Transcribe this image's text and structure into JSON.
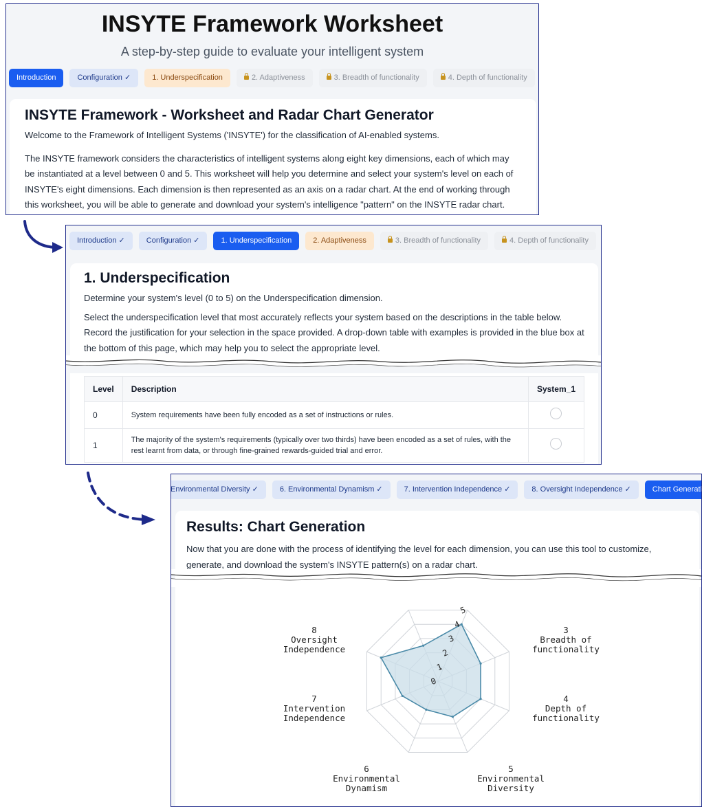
{
  "panel1": {
    "title": "INSYTE Framework Worksheet",
    "subtitle": "A step-by-step guide to evaluate your intelligent system",
    "tabs": [
      {
        "label": "Introduction"
      },
      {
        "label": "Configuration ✓"
      },
      {
        "label": "1. Underspecification"
      },
      {
        "label": "2. Adaptiveness"
      },
      {
        "label": "3. Breadth of functionality"
      },
      {
        "label": "4. Depth of functionality"
      }
    ],
    "card_title": "INSYTE Framework - Worksheet and Radar Chart Generator",
    "welcome": "Welcome to the Framework of Intelligent Systems ('INSYTE') for the classification of AI-enabled systems.",
    "body": "The INSYTE framework considers the characteristics of intelligent systems along eight key dimensions, each of which may be instantiated at a level between 0 and 5. This worksheet will help you determine and select your system's level on each of INSYTE's eight dimensions. Each dimension is then represented as an axis on a radar chart. At the end of working through this worksheet, you will be able to generate and download your system's intelligence \"pattern\" on the INSYTE radar chart."
  },
  "panel2": {
    "tabs": [
      {
        "label": "Introduction ✓"
      },
      {
        "label": "Configuration ✓"
      },
      {
        "label": "1. Underspecification"
      },
      {
        "label": "2. Adaptiveness"
      },
      {
        "label": "3. Breadth of functionality"
      },
      {
        "label": "4. Depth of functionality"
      }
    ],
    "card_title": "1. Underspecification",
    "intro": "Determine your system's level (0 to 5) on the Underspecification dimension.",
    "instructions": "Select the underspecification level that most accurately reflects your system based on the descriptions in the table below. Record the justification for your selection in the space provided. A drop-down table with examples is provided in the blue box at the bottom of this page, which may help you to select the appropriate level.",
    "table": {
      "headers": [
        "Level",
        "Description",
        "System_1"
      ],
      "rows": [
        {
          "level": "0",
          "description": "System requirements have been fully encoded as a set of instructions or rules."
        },
        {
          "level": "1",
          "description": "The majority of the system's requirements (typically over two thirds) have been encoded as a set of rules, with the rest learnt from data, or through fine-grained rewards-guided trial and error."
        }
      ]
    }
  },
  "panel3": {
    "tabs": [
      {
        "label": "Environmental Diversity ✓"
      },
      {
        "label": "6. Environmental Dynamism ✓"
      },
      {
        "label": "7. Intervention Independence ✓"
      },
      {
        "label": "8. Oversight Independence ✓"
      },
      {
        "label": "Chart Generation"
      }
    ],
    "card_title": "Results: Chart Generation",
    "body": "Now that you are done with the process of identifying the level for each dimension, you can use this tool to customize, generate, and download the system's INSYTE pattern(s) on a radar chart."
  },
  "chart_data": {
    "type": "radar",
    "axes": [
      {
        "num": "1",
        "lines": [
          "Underspecification"
        ]
      },
      {
        "num": "2",
        "lines": [
          "Adaptiveness"
        ]
      },
      {
        "num": "3",
        "lines": [
          "Breadth of",
          "functionality"
        ]
      },
      {
        "num": "4",
        "lines": [
          "Depth of",
          "functionality"
        ]
      },
      {
        "num": "5",
        "lines": [
          "Environmental",
          "Diversity"
        ]
      },
      {
        "num": "6",
        "lines": [
          "Environmental",
          "Dynamism"
        ]
      },
      {
        "num": "7",
        "lines": [
          "Intervention",
          "Independence"
        ]
      },
      {
        "num": "8",
        "lines": [
          "Oversight",
          "Independence"
        ]
      }
    ],
    "ticks": [
      "0",
      "1",
      "2",
      "3",
      "4",
      "5"
    ],
    "range": [
      0,
      5
    ],
    "series": [
      {
        "values": [
          4,
          3,
          3,
          2.5,
          2,
          2.5,
          4,
          2.5
        ]
      }
    ],
    "colors": {
      "fill": "#c9dde8",
      "line": "#4a8aa8",
      "grid": "#d0d4d9"
    }
  },
  "colors": {
    "accent": "#1a5df0",
    "frame": "#1e2a8a",
    "arrow": "#1e2a8a"
  }
}
